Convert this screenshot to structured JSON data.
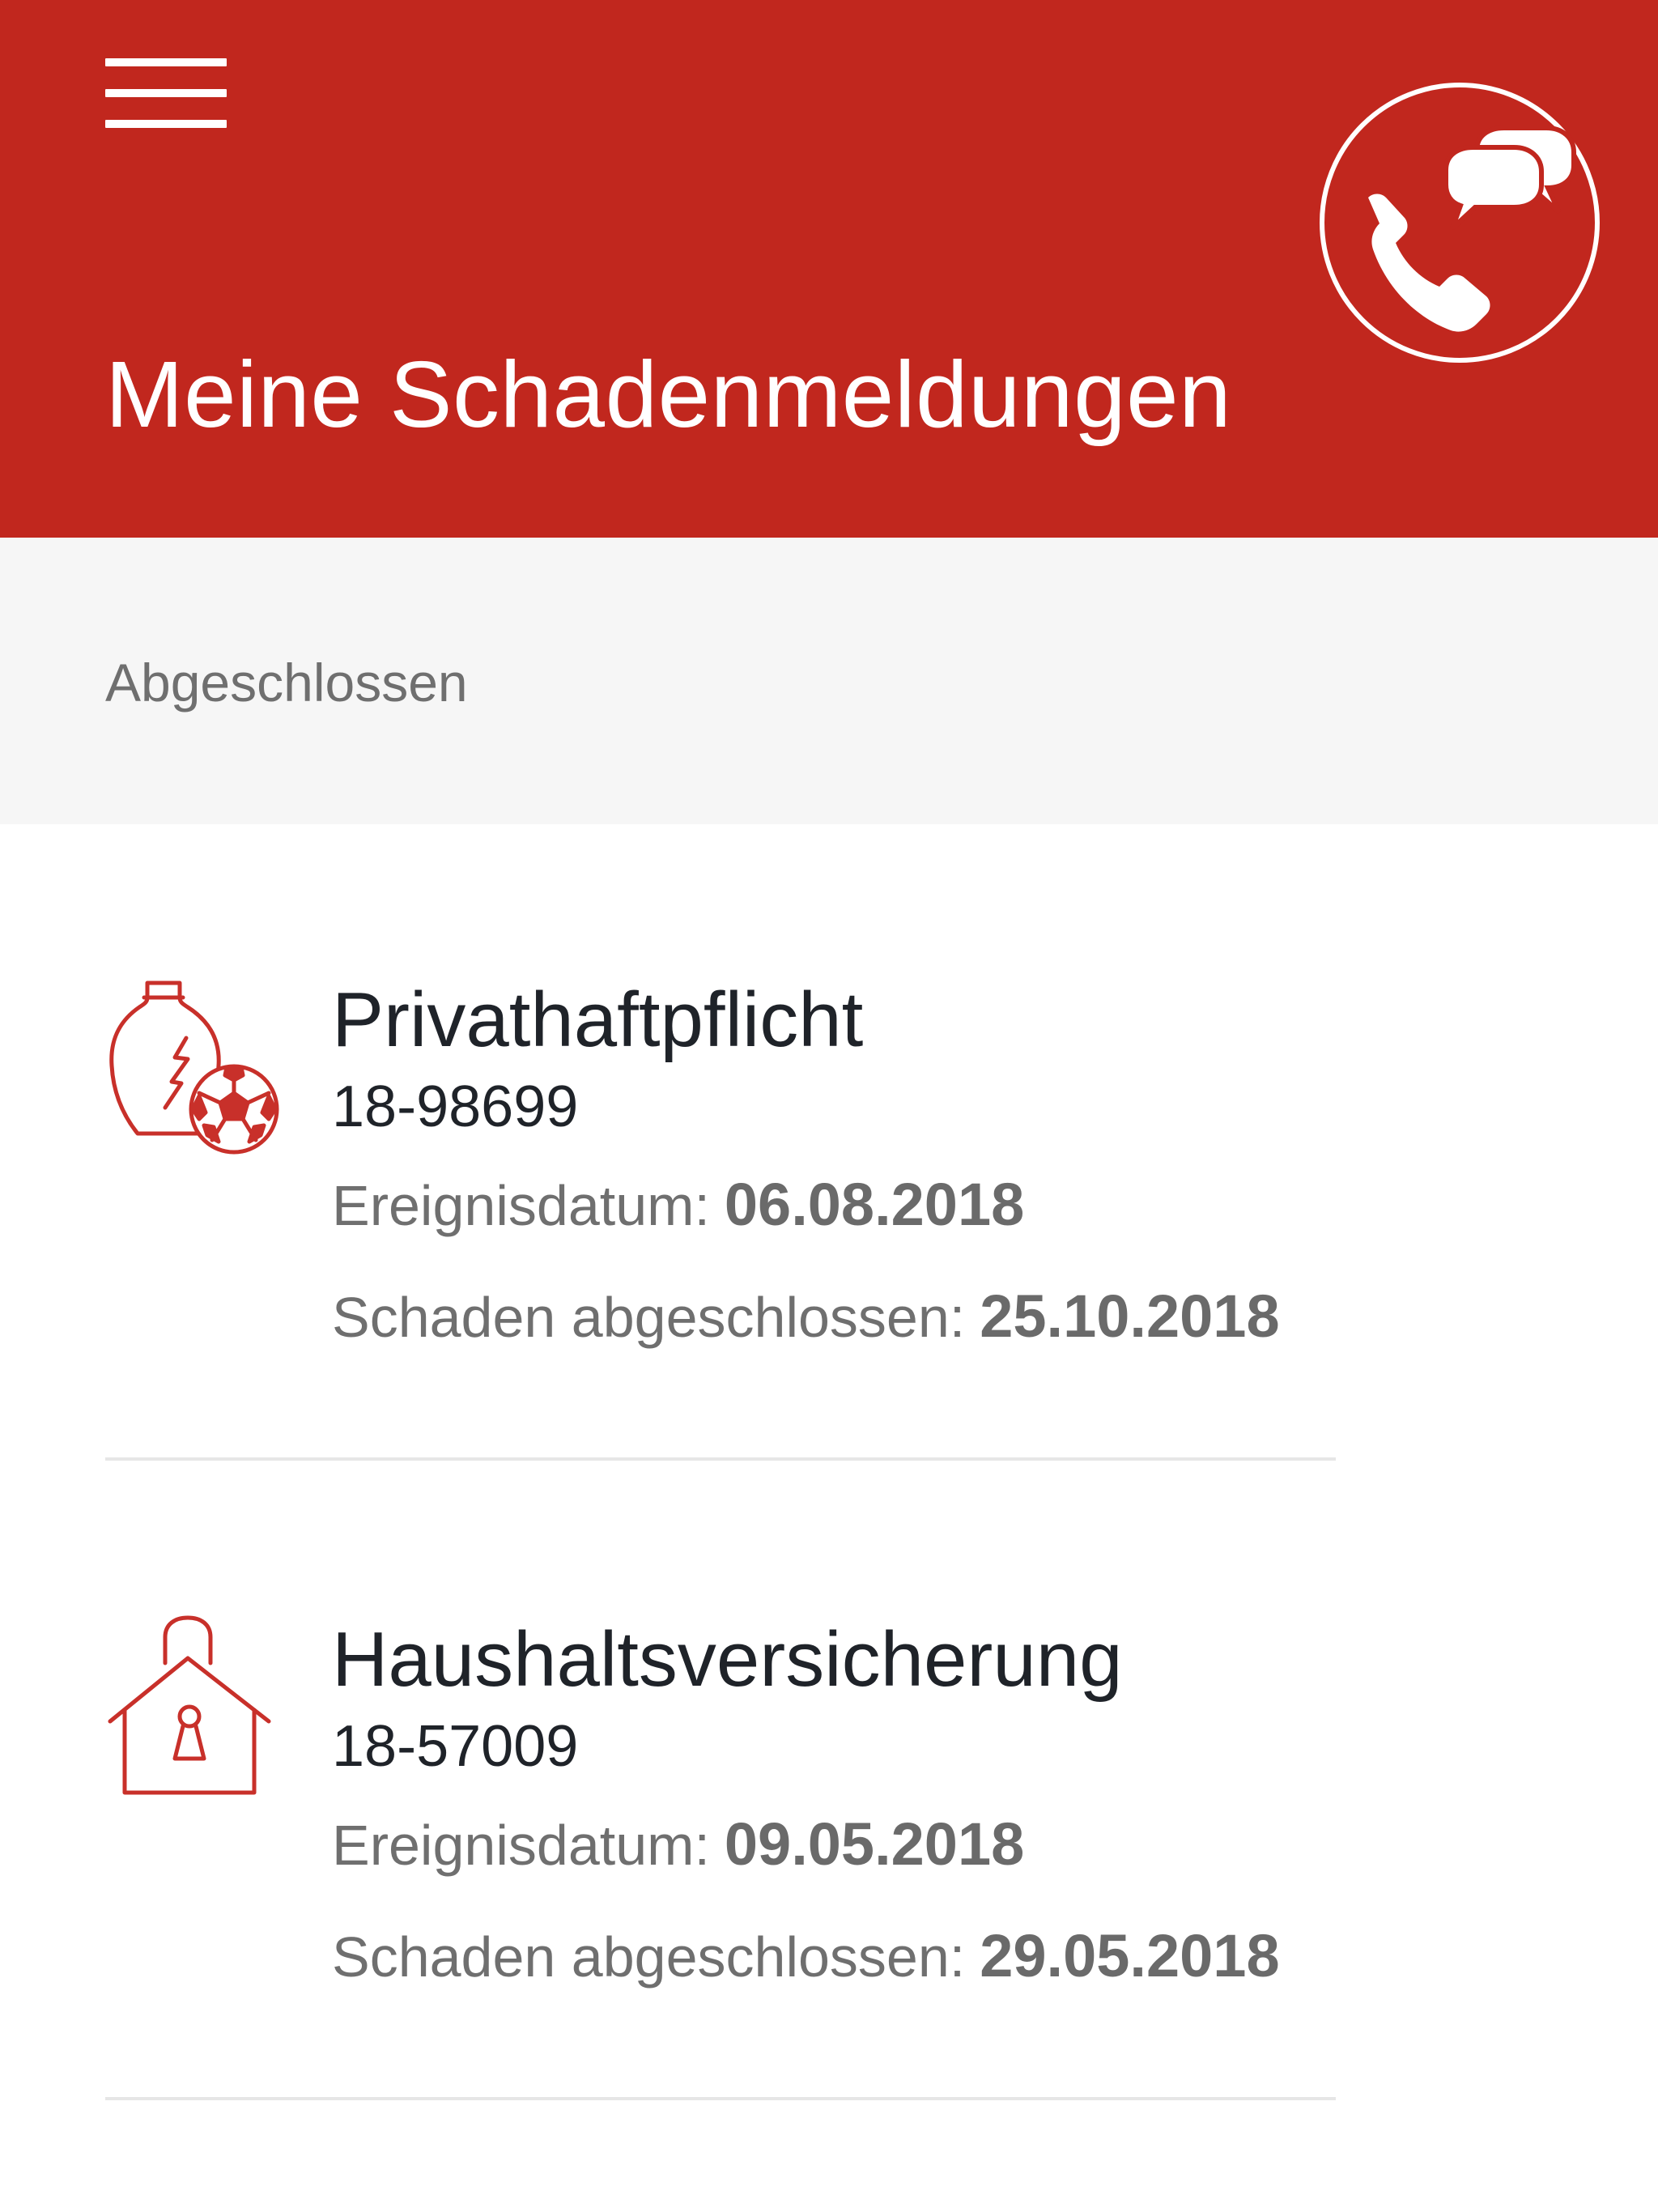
{
  "header": {
    "title": "Meine Schadenmeldungen",
    "menu_icon": "hamburger-menu-icon",
    "contact_icon": "phone-chat-icon",
    "background_color": "#c1271e"
  },
  "section": {
    "title": "Abgeschlossen"
  },
  "claims": [
    {
      "icon": "broken-vase-ball-icon",
      "type": "Privathaftpflicht",
      "number": "18-98699",
      "event_date_label": "Ereignisdatum:",
      "event_date": "06.08.2018",
      "closed_label": "Schaden abgeschlossen:",
      "closed_date": "25.10.2018"
    },
    {
      "icon": "house-lock-icon",
      "type": "Haushaltsversicherung",
      "number": "18-57009",
      "event_date_label": "Ereignisdatum:",
      "event_date": "09.05.2018",
      "closed_label": "Schaden abgeschlossen:",
      "closed_date": "29.05.2018"
    }
  ],
  "colors": {
    "brand_red": "#c1271e",
    "icon_red": "#c8302a",
    "text_dark": "#1f2329",
    "text_grey": "#6f6f6f",
    "band_grey": "#f6f6f6",
    "divider": "#e6e6e6"
  }
}
